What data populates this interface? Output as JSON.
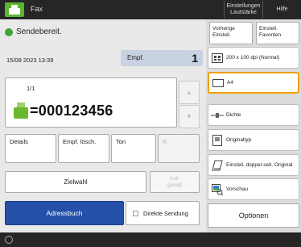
{
  "topbar": {
    "app_title": "Fax",
    "settings_label": "Einstellungen Lautstärke",
    "help_label": "Hilfe"
  },
  "status": {
    "text": "Sendebereit."
  },
  "main": {
    "datetime": "15/08 2023 13:39",
    "dest_tab_label": "Empf.",
    "dest_count": "1",
    "dest_index": "1/1",
    "fax_number": "=000123456",
    "actions": {
      "details": "Details",
      "delete": "Empf. lösch.",
      "tone": "Ton",
      "r": "R"
    },
    "shortcut": "Zielwahl",
    "onhook": "Auf-\ngelegt",
    "address_book": "Adressbuch",
    "direct_send": "Direkte Sendung"
  },
  "right": {
    "prev_settings": "Vorherige Einstell.",
    "favorites": "Einstell. Favoriten",
    "resolution": "200 x 100 dpi (Normal)",
    "size": "A4",
    "density": "Dichte",
    "original_type": "Originaltyp",
    "duplex": "Einstell. doppel-seit. Original",
    "preview": "Vorschau",
    "options": "Optionen"
  },
  "colors": {
    "accent": "#2450a8",
    "selected": "#f0a000",
    "ok": "#3da33a",
    "fax_green": "#68b82b"
  }
}
